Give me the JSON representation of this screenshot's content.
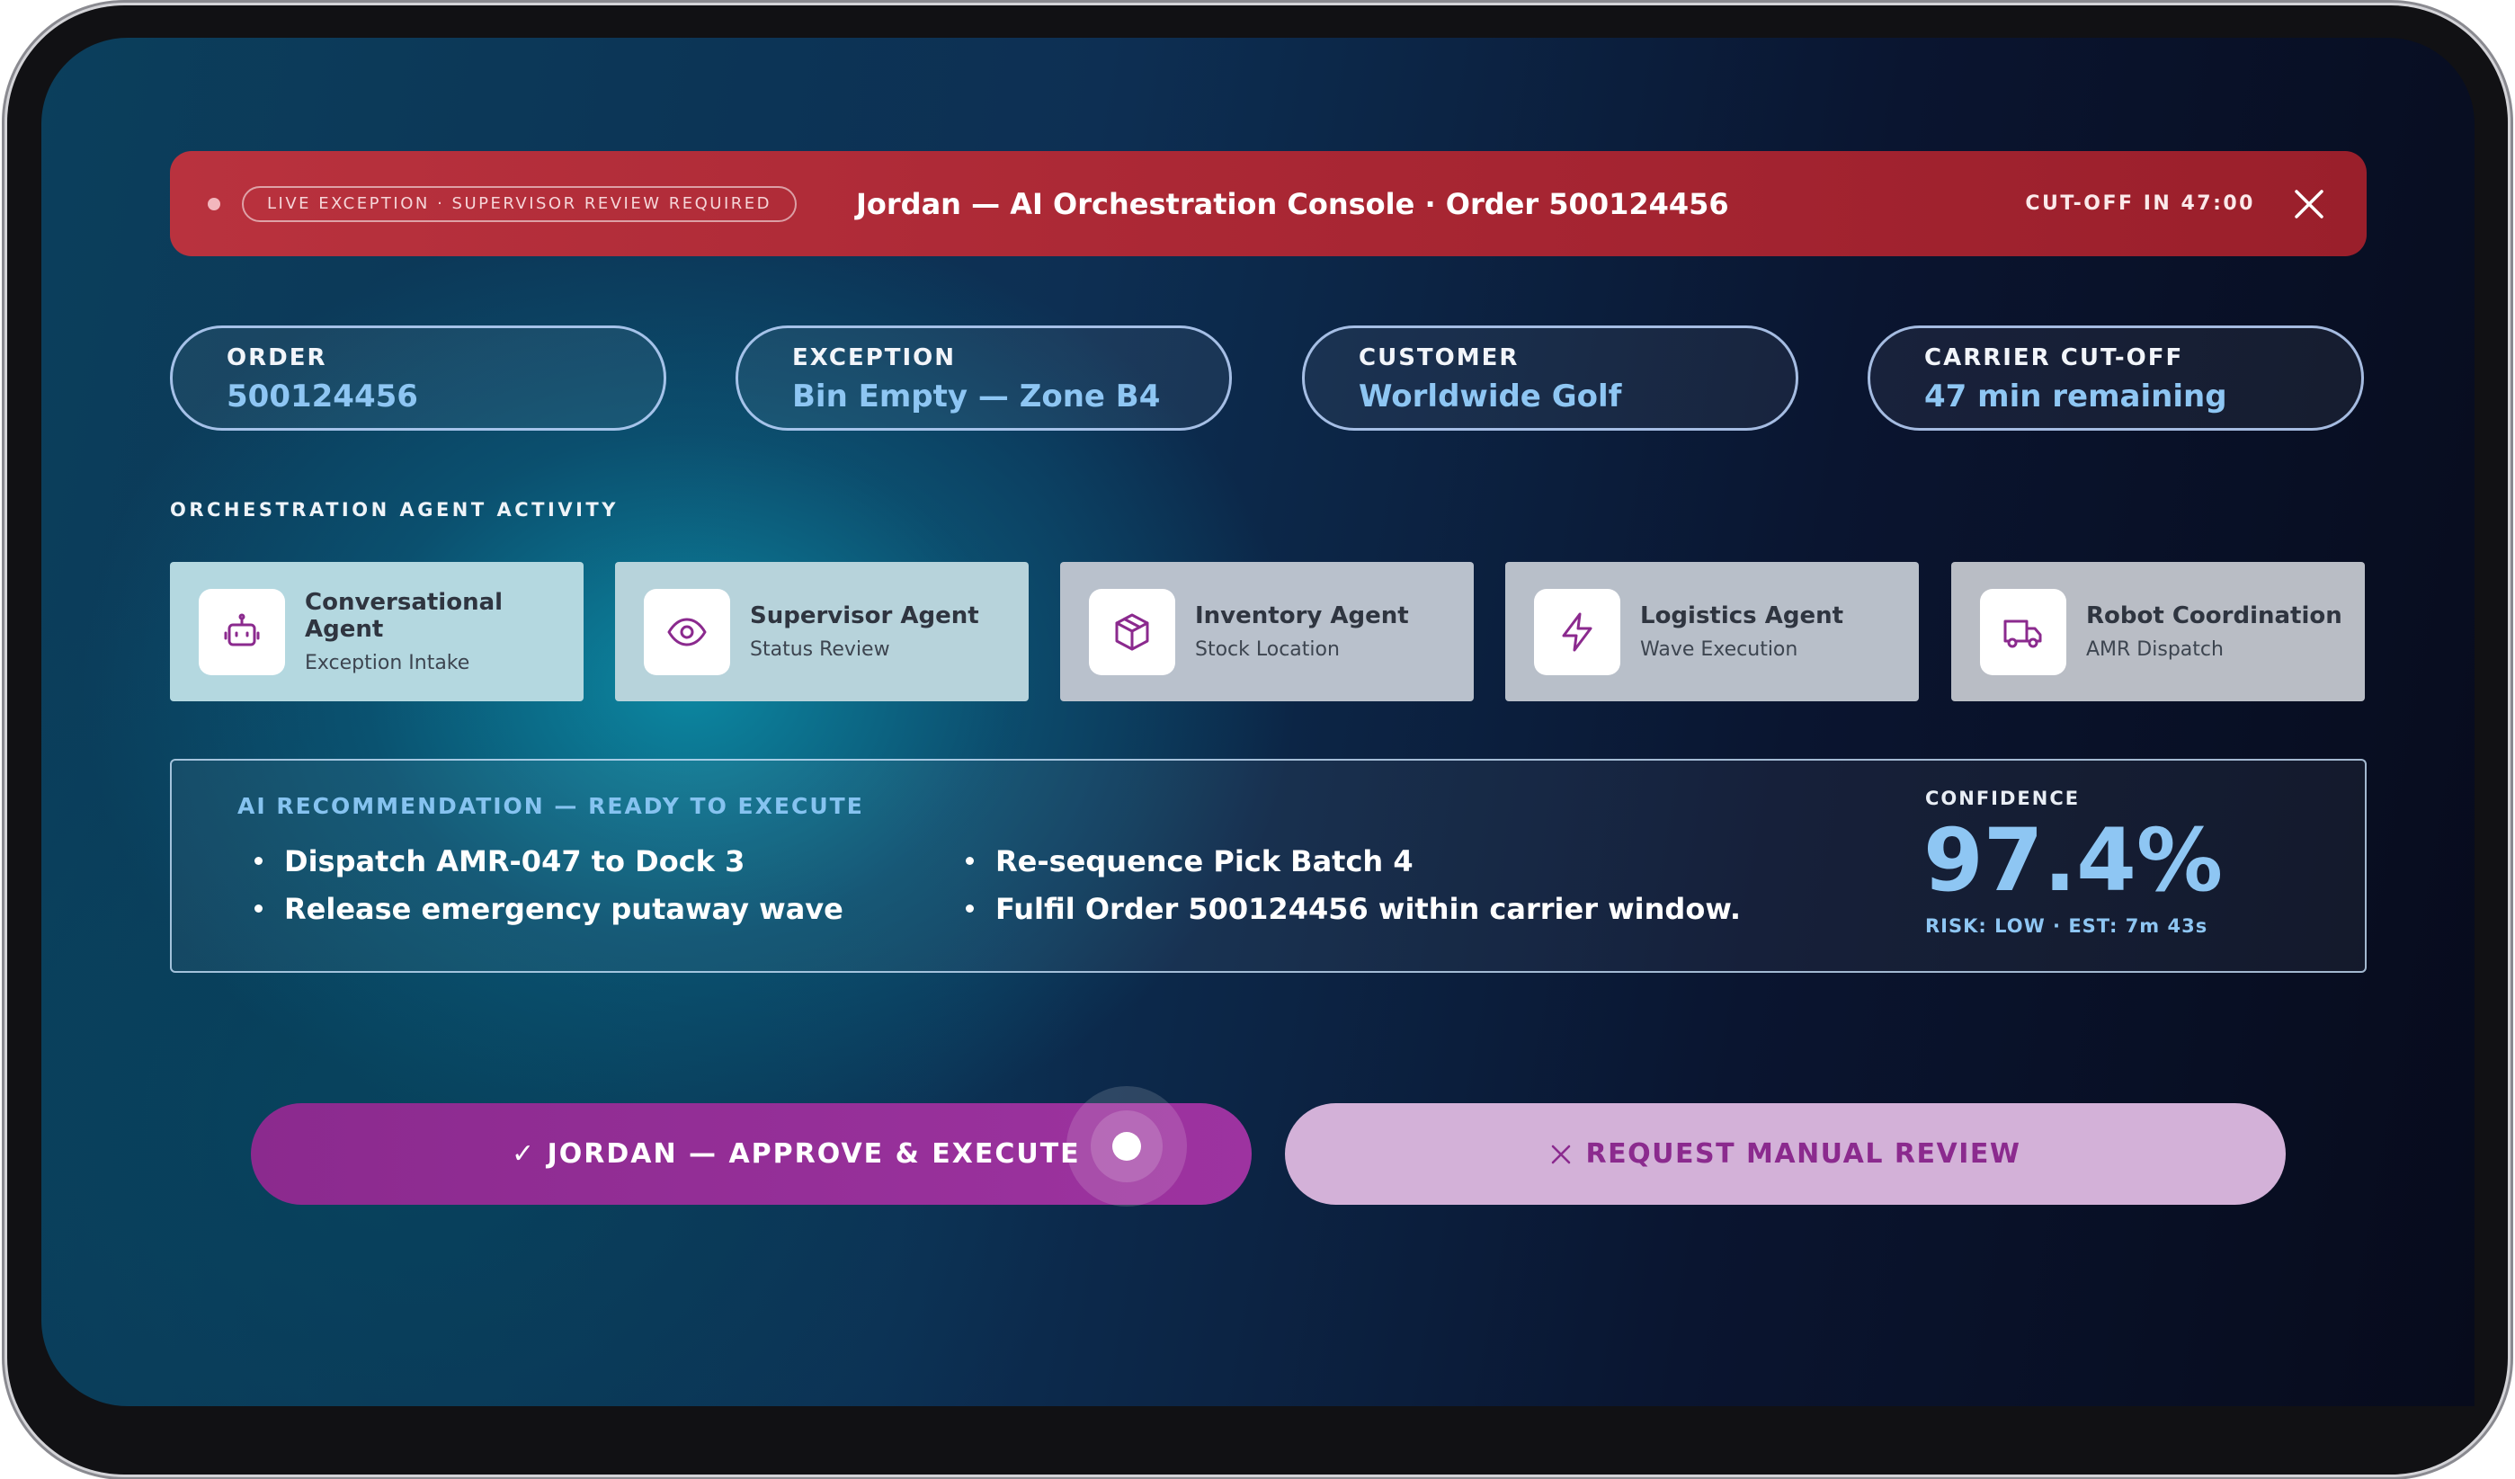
{
  "banner": {
    "status_pill": "LIVE EXCEPTION · SUPERVISOR REVIEW REQUIRED",
    "title": "Jordan — AI Orchestration Console · Order 500124456",
    "cutoff": "CUT-OFF IN 47:00",
    "close_icon": "close-icon"
  },
  "info": {
    "order": {
      "label": "ORDER",
      "value": "500124456"
    },
    "exception": {
      "label": "EXCEPTION",
      "value": "Bin Empty — Zone B4"
    },
    "customer": {
      "label": "CUSTOMER",
      "value": "Worldwide Golf"
    },
    "carrier": {
      "label": "CARRIER CUT-OFF",
      "value": "47 min remaining"
    }
  },
  "agents_section": {
    "label": "ORCHESTRATION AGENT ACTIVITY",
    "agents": [
      {
        "name": "Conversational Agent",
        "sub": "Exception Intake",
        "icon": "robot-icon"
      },
      {
        "name": "Supervisor Agent",
        "sub": "Status Review",
        "icon": "eye-icon"
      },
      {
        "name": "Inventory Agent",
        "sub": "Stock Location",
        "icon": "package-icon"
      },
      {
        "name": "Logistics Agent",
        "sub": "Wave Execution",
        "icon": "lightning-icon"
      },
      {
        "name": "Robot Coordination",
        "sub": "AMR Dispatch",
        "icon": "truck-icon"
      }
    ]
  },
  "recommendation": {
    "title": "AI RECOMMENDATION — READY TO EXECUTE",
    "items_left": [
      "Dispatch AMR-047 to Dock 3",
      "Release emergency putaway wave"
    ],
    "items_right": [
      "Re-sequence Pick Batch 4",
      "Fulfil Order 500124456 within carrier window."
    ],
    "confidence_label": "CONFIDENCE",
    "confidence_value": "97.4%",
    "risk": "RISK: LOW · EST: 7m 43s"
  },
  "actions": {
    "approve": "✓ JORDAN — APPROVE & EXECUTE",
    "review": "REQUEST MANUAL REVIEW"
  },
  "colors": {
    "banner": "#a82633",
    "accent": "#8ec6f3",
    "primary_button": "#9d33a0",
    "secondary_button": "#d3b1d8",
    "icon_purple": "#8b2a8e"
  }
}
